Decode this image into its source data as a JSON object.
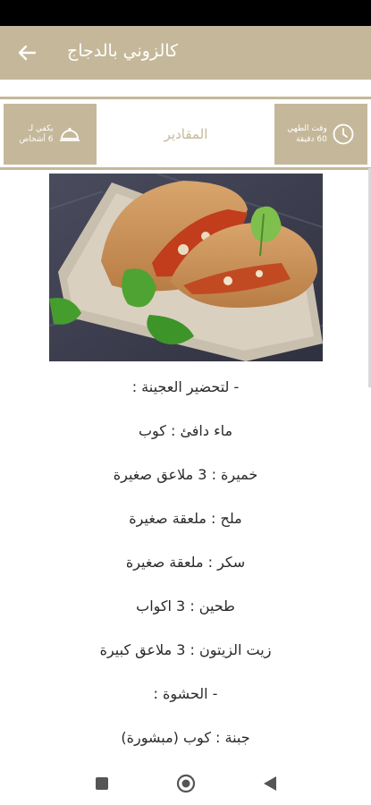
{
  "appbar": {
    "title": "كالزوني بالدجاج",
    "back_icon": "arrow-left-icon"
  },
  "info": {
    "cook_time_label": "وقت الطهي",
    "cook_time_value": "60 دقيقة",
    "ingredients_tab": "المقادير",
    "serves_label": "يكفي لـ",
    "serves_value": "6 أشخاص"
  },
  "ingredients": [
    "- لتحضير العجينة :",
    "ماء دافئ : كوب",
    "خميرة : 3 ملاعق صغيرة",
    "ملح : ملعقة صغيرة",
    "سكر : ملعقة صغيرة",
    "طحين : 3 اكواب",
    "زيت الزيتون : 3 ملاعق كبيرة",
    "- الحشوة :",
    "جبنة : كوب (مبشورة)"
  ],
  "colors": {
    "accent": "#c5b89a",
    "white": "#ffffff"
  }
}
